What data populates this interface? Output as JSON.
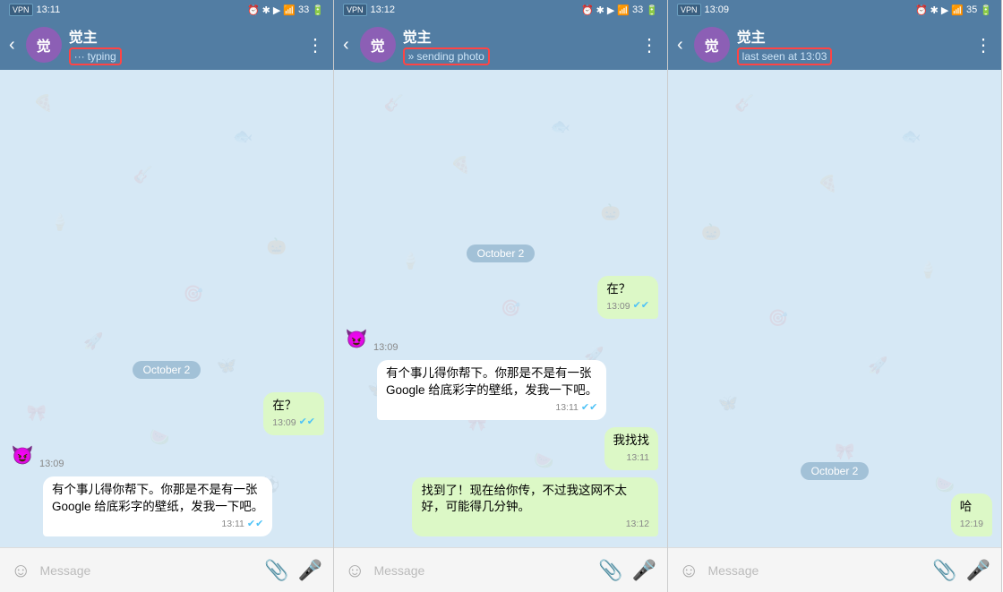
{
  "panels": [
    {
      "id": "panel1",
      "statusBar": {
        "time": "13:11",
        "vpn": "VPN",
        "icons": "⏰ ✱ ▶ 📶 🔋",
        "signal": "33"
      },
      "header": {
        "name": "觉主",
        "avatarText": "觉",
        "status": "typing",
        "statusIcon": "···",
        "statusHighlight": true,
        "statusPrefix": "···"
      },
      "dateSeparator": "October 2",
      "messages": [
        {
          "type": "outgoing",
          "text": "在？",
          "time": "13:09",
          "checks": "✔✔"
        },
        {
          "type": "incoming",
          "emoji": "😈",
          "time": "13:09"
        },
        {
          "type": "incoming-bubble",
          "text": "有个事儿得你帮下。你那是不是有一张\nGoogle 给底彩字的壁纸，发我一下吧。",
          "time": "13:11",
          "checks": "✔✔"
        }
      ]
    },
    {
      "id": "panel2",
      "statusBar": {
        "time": "13:12",
        "vpn": "VPN",
        "signal": "33"
      },
      "header": {
        "name": "觉主",
        "avatarText": "觉",
        "status": "sending photo",
        "statusIcon": "»",
        "statusHighlight": true,
        "statusPrefix": "»"
      },
      "dateSeparator": "October 2",
      "messages": [
        {
          "type": "outgoing",
          "text": "在？",
          "time": "13:09",
          "checks": "✔✔"
        },
        {
          "type": "incoming",
          "emoji": "😈",
          "time": "13:09"
        },
        {
          "type": "incoming-bubble",
          "text": "有个事儿得你帮下。你那是不是有一张\nGoogle 给底彩字的壁纸，发我一下吧。",
          "time": "13:11",
          "checks": "✔✔"
        },
        {
          "type": "outgoing",
          "text": "我找找",
          "time": "13:11",
          "checks": ""
        },
        {
          "type": "outgoing",
          "text": "找到了！现在给你传，不过我这网不太好，可能得几分钟。",
          "time": "13:12",
          "checks": ""
        }
      ]
    },
    {
      "id": "panel3",
      "statusBar": {
        "time": "13:09",
        "vpn": "VPN",
        "signal": "35"
      },
      "header": {
        "name": "觉主",
        "avatarText": "觉",
        "status": "last seen at 13:03",
        "statusHighlight": true,
        "statusPrefix": ""
      },
      "dateSeparator": "October 2",
      "messages": [
        {
          "type": "outgoing",
          "text": "哈",
          "time": "12:19",
          "checks": ""
        }
      ]
    }
  ],
  "bottomBar": {
    "placeholder": "Message",
    "emojiIcon": "☺",
    "attachIcon": "📎",
    "micIcon": "🎤"
  }
}
